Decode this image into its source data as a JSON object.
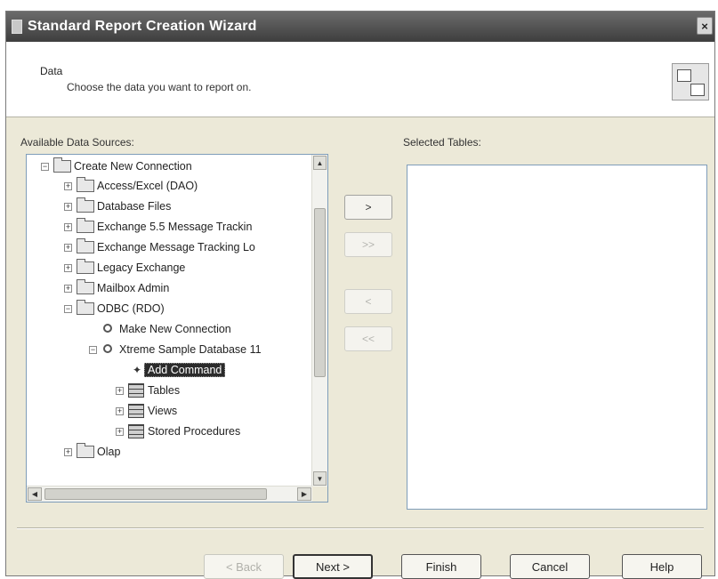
{
  "window": {
    "title": "Standard Report Creation Wizard",
    "close_glyph": "×"
  },
  "header": {
    "title": "Data",
    "subtitle": "Choose the data you want to report on."
  },
  "left": {
    "label": "Available Data Sources:",
    "tree": [
      {
        "label": "Create New Connection",
        "expander": "−",
        "icon": "folder-icon"
      },
      {
        "label": "Access/Excel (DAO)",
        "expander": "+",
        "icon": "folder-icon"
      },
      {
        "label": "Database Files",
        "expander": "+",
        "icon": "folder-icon"
      },
      {
        "label": "Exchange 5.5 Message Trackin",
        "expander": "+",
        "icon": "folder-icon"
      },
      {
        "label": "Exchange Message Tracking Lo",
        "expander": "+",
        "icon": "folder-icon"
      },
      {
        "label": "Legacy Exchange",
        "expander": "+",
        "icon": "folder-icon"
      },
      {
        "label": "Mailbox Admin",
        "expander": "+",
        "icon": "folder-icon"
      },
      {
        "label": "ODBC (RDO)",
        "expander": "−",
        "icon": "folder-icon"
      },
      {
        "label": "Make New Connection",
        "expander": "",
        "icon": "connection-icon"
      },
      {
        "label": "Xtreme Sample Database 11",
        "expander": "−",
        "icon": "connection-icon"
      },
      {
        "label": "Add Command",
        "expander": "",
        "icon": "command-icon"
      },
      {
        "label": "Tables",
        "expander": "+",
        "icon": "database-icon"
      },
      {
        "label": "Views",
        "expander": "+",
        "icon": "database-icon"
      },
      {
        "label": "Stored Procedures",
        "expander": "+",
        "icon": "database-icon"
      },
      {
        "label": "Olap",
        "expander": "+",
        "icon": "folder-icon"
      }
    ]
  },
  "move_buttons": [
    ">",
    ">>",
    "<",
    "<<"
  ],
  "right": {
    "label": "Selected Tables:"
  },
  "footer": {
    "back": "< Back",
    "next": "Next >",
    "finish": "Finish",
    "cancel": "Cancel",
    "help": "Help"
  }
}
